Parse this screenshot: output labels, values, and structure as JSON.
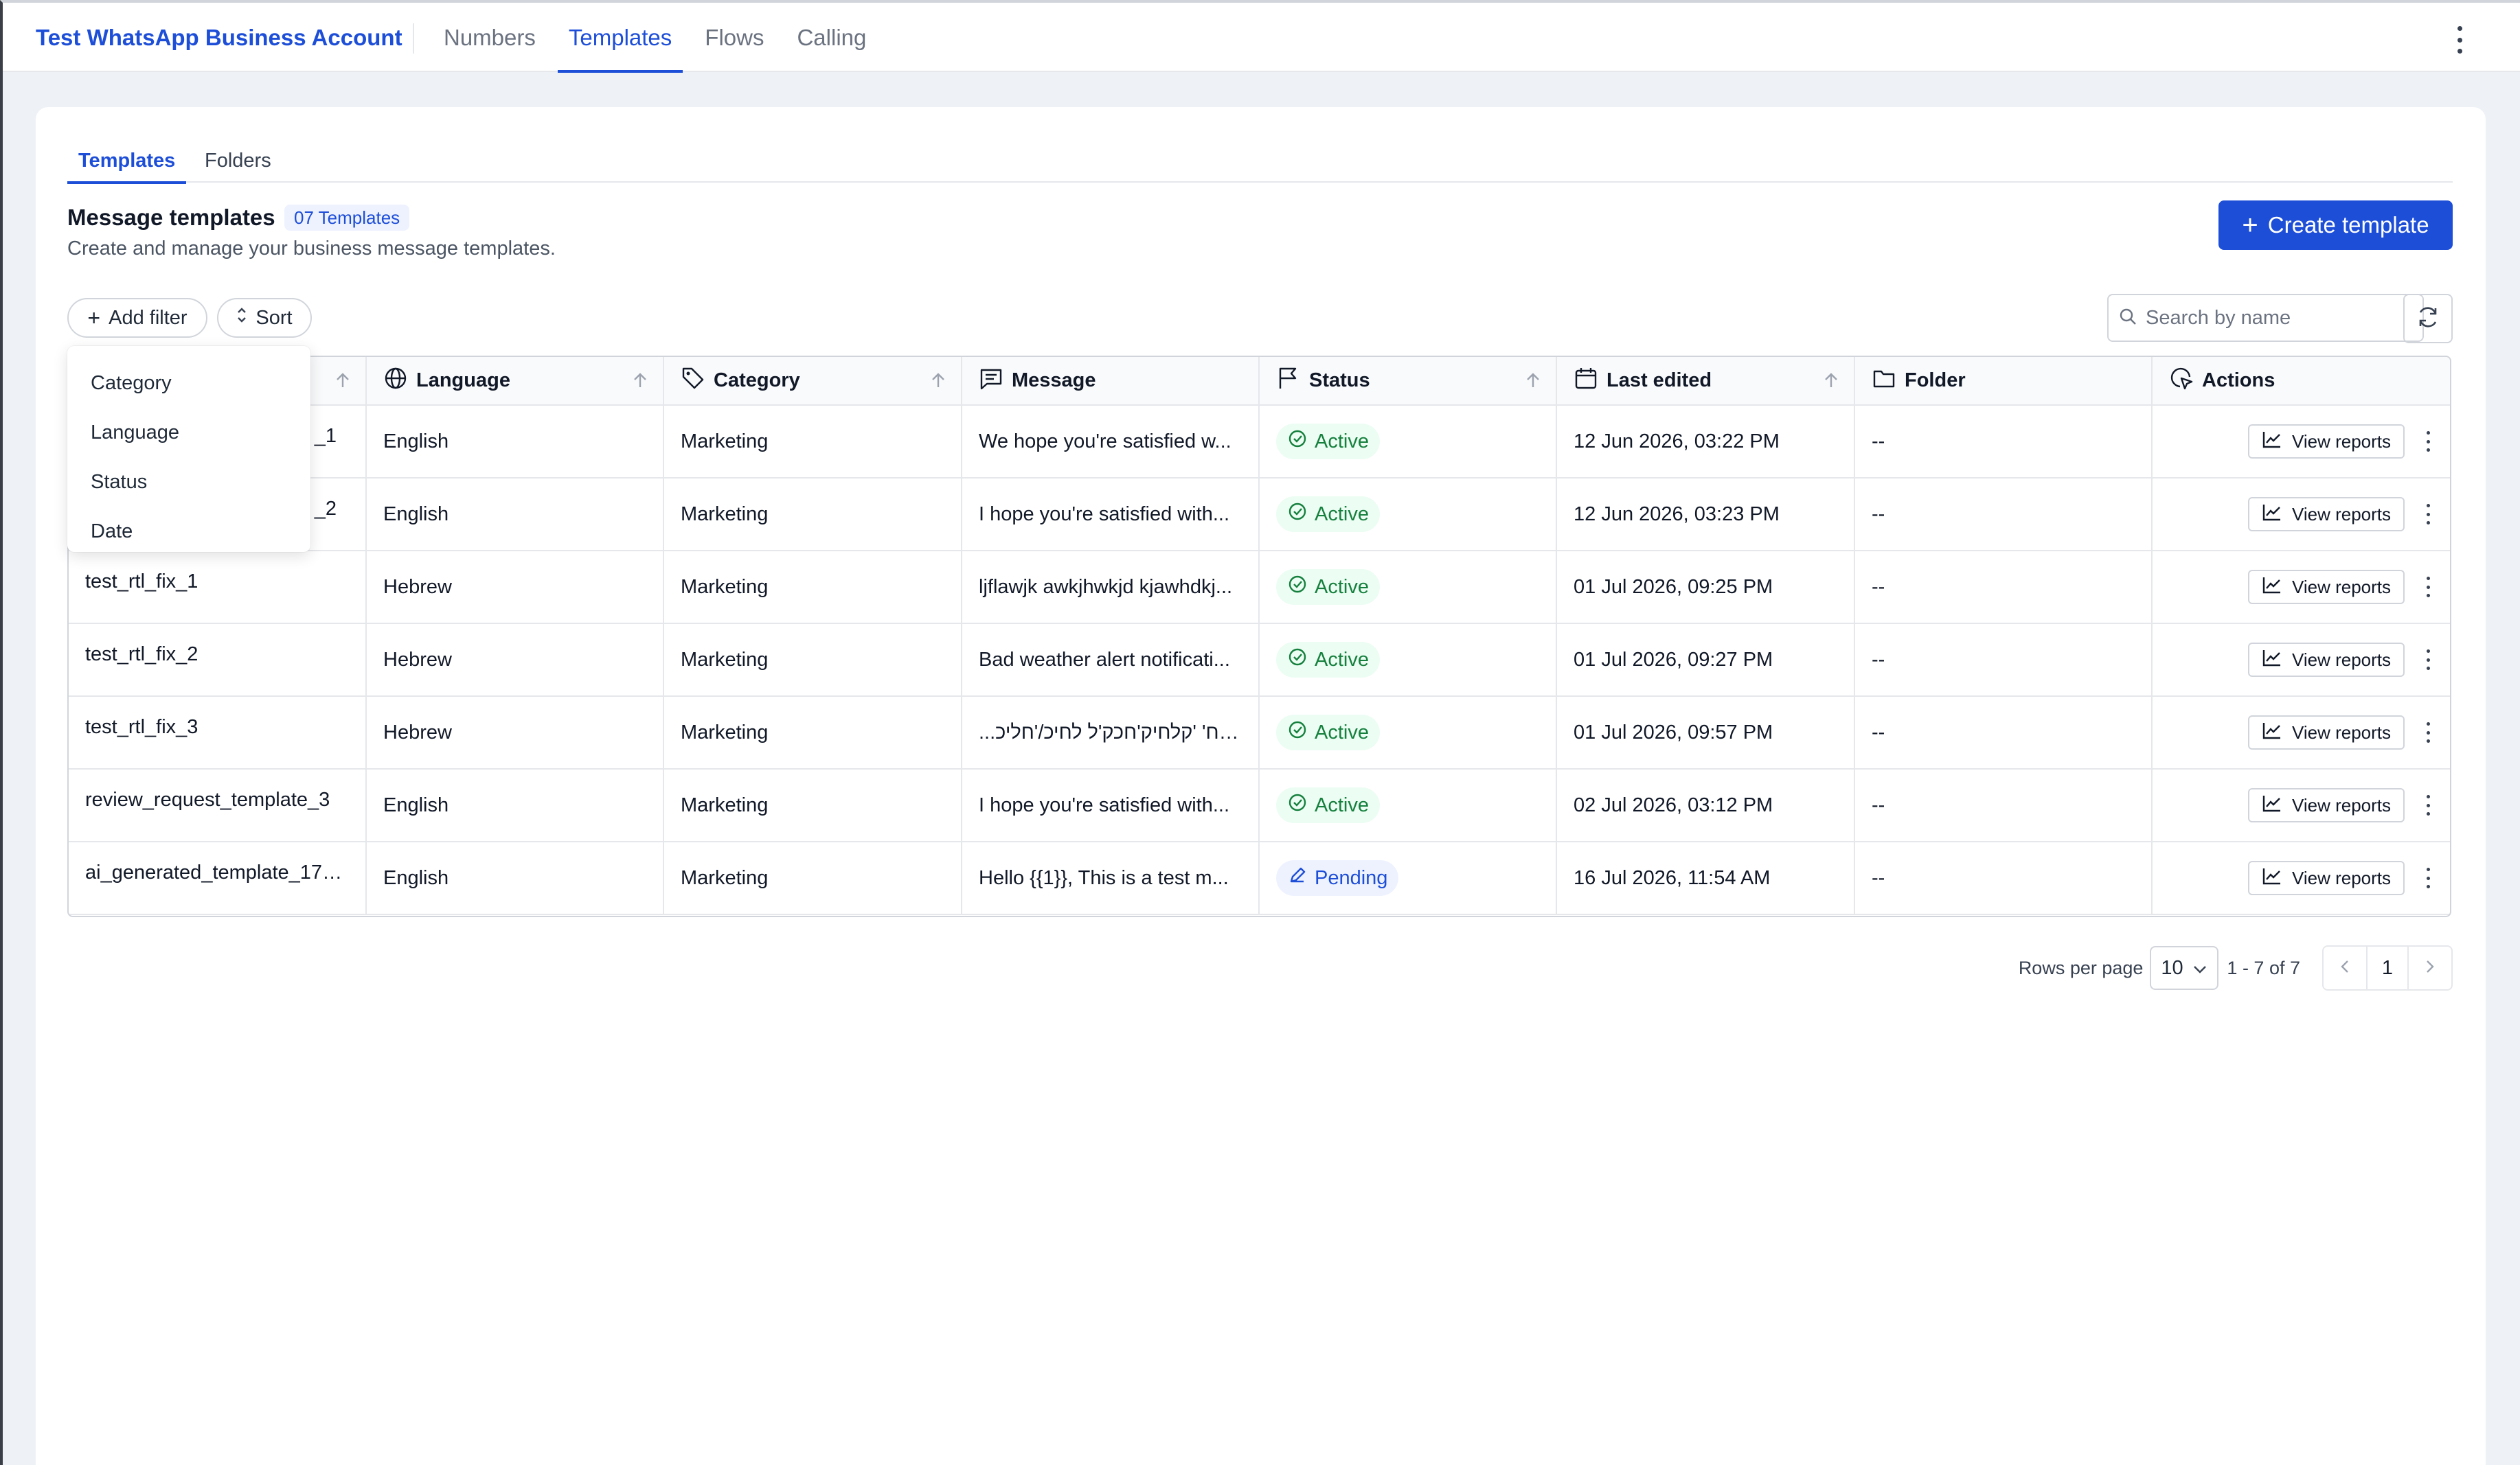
{
  "header": {
    "brand": "Test WhatsApp Business Account",
    "tabs": [
      {
        "label": "Numbers"
      },
      {
        "label": "Templates"
      },
      {
        "label": "Flows"
      },
      {
        "label": "Calling"
      }
    ],
    "active_tab": "Templates"
  },
  "subtabs": [
    {
      "label": "Templates"
    },
    {
      "label": "Folders"
    }
  ],
  "section": {
    "title": "Message templates",
    "count_badge": "07 Templates",
    "subtitle": "Create and manage your business message templates.",
    "create_button": "Create template"
  },
  "toolbar": {
    "add_filter": "Add filter",
    "sort": "Sort",
    "search_placeholder": "Search by name"
  },
  "filter_menu": {
    "items": [
      {
        "label": "Category"
      },
      {
        "label": "Language"
      },
      {
        "label": "Status"
      },
      {
        "label": "Date"
      }
    ]
  },
  "table": {
    "columns": [
      "Language",
      "Category",
      "Message",
      "Status",
      "Last edited",
      "Folder",
      "Actions"
    ],
    "rows": [
      {
        "name": "_1",
        "language": "English",
        "category": "Marketing",
        "message": "We hope you're satisfied w...",
        "status": "Active",
        "last_edited": "12 Jun 2026, 03:22 PM",
        "folder": "--",
        "action": "View reports"
      },
      {
        "name": "_2",
        "language": "English",
        "category": "Marketing",
        "message": "I hope you're satisfied with...",
        "status": "Active",
        "last_edited": "12 Jun 2026, 03:23 PM",
        "folder": "--",
        "action": "View reports"
      },
      {
        "name": "test_rtl_fix_1",
        "language": "Hebrew",
        "category": "Marketing",
        "message": "ljflawjk awkjhwkjd kjawhdkj...",
        "status": "Active",
        "last_edited": "01 Jul 2026, 09:25 PM",
        "folder": "--",
        "action": "View reports"
      },
      {
        "name": "test_rtl_fix_2",
        "language": "Hebrew",
        "category": "Marketing",
        "message": "Bad weather alert notificati...",
        "status": "Active",
        "last_edited": "01 Jul 2026, 09:27 PM",
        "folder": "--",
        "action": "View reports"
      },
      {
        "name": "test_rtl_fix_3",
        "language": "Hebrew",
        "category": "Marketing",
        "message": "...יכלח' 'קלחיק'חכק'ל לחיכ/'חליכ",
        "status": "Active",
        "last_edited": "01 Jul 2026, 09:57 PM",
        "folder": "--",
        "action": "View reports"
      },
      {
        "name": "review_request_template_3",
        "language": "English",
        "category": "Marketing",
        "message": "I hope you're satisfied with...",
        "status": "Active",
        "last_edited": "02 Jul 2026, 03:12 PM",
        "folder": "--",
        "action": "View reports"
      },
      {
        "name": "ai_generated_template_178...",
        "language": "English",
        "category": "Marketing",
        "message": "Hello {{1}}, This is a test m...",
        "status": "Pending",
        "last_edited": "16 Jul 2026, 11:54 AM",
        "folder": "--",
        "action": "View reports"
      }
    ]
  },
  "pagination": {
    "rows_label": "Rows per page",
    "rows_value": "10",
    "range": "1 - 7 of 7",
    "page": "1"
  },
  "colors": {
    "accent": "#1d4ed8",
    "active_green": "#15803d",
    "active_bg": "#ecfdf3",
    "pending_bg": "#eef2ff"
  }
}
